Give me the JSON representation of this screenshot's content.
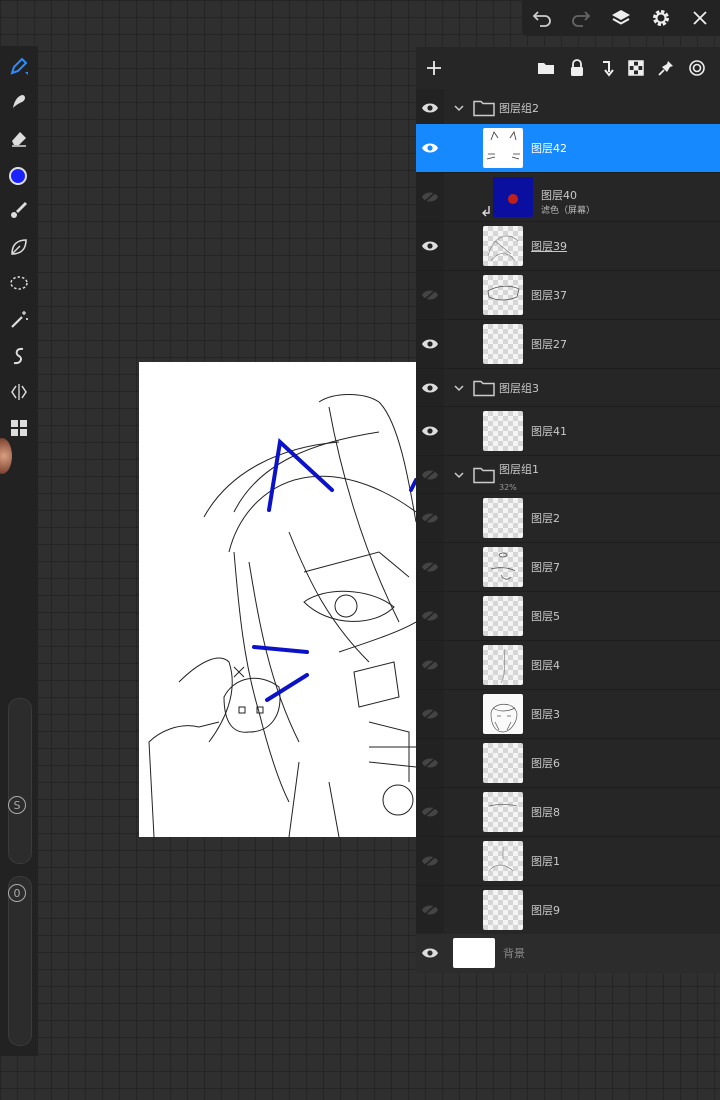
{
  "layers_panel": {
    "groups": {
      "group2": "图层组2",
      "group3": "图层组3",
      "group1": "图层组1",
      "group1_opacity": "32%"
    },
    "layers": {
      "layer42": "图层42",
      "layer40": "图层40",
      "layer40_blend": "滤色（屏幕）",
      "layer39": "图层39",
      "layer37": "图层37",
      "layer27": "图层27",
      "layer41": "图层41",
      "layer2": "图层2",
      "layer7": "图层7",
      "layer5": "图层5",
      "layer4": "图层4",
      "layer3": "图层3",
      "layer6": "图层6",
      "layer8": "图层8",
      "layer1": "图层1",
      "layer9": "图层9"
    },
    "background": "背景"
  },
  "sliders": {
    "size_label": "S",
    "opacity_label": "0"
  },
  "colors": {
    "selected_row": "#1689ff",
    "current_color": "#1a22ff",
    "panel_bg": "#262626"
  },
  "icons": {
    "top_bar": [
      "undo-icon",
      "redo-icon",
      "layers-icon",
      "settings-icon",
      "close-icon"
    ],
    "panel_header": [
      "add-icon",
      "folder-icon",
      "lock-icon",
      "merge-down-icon",
      "checkerboard-icon",
      "pin-icon",
      "reference-icon"
    ]
  }
}
